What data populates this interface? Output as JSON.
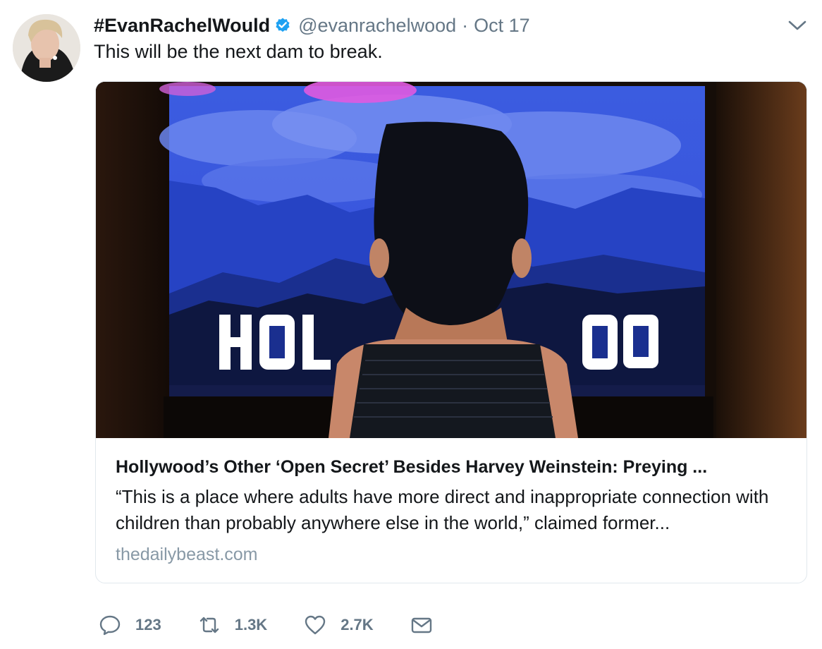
{
  "tweet": {
    "display_name": "#EvanRachelWould",
    "handle": "@evanrachelwood",
    "separator": "·",
    "date": "Oct 17",
    "text": "This will be the next dam to break."
  },
  "card": {
    "image_sign_text": "HOLLYWOOD",
    "title": "Hollywood’s Other ‘Open Secret’ Besides Harvey Weinstein: Preying ...",
    "description": "“This is a place where adults have more direct and inappropriate connection with children than probably anywhere else in the world,” claimed former...",
    "domain": "thedailybeast.com"
  },
  "actions": {
    "replies": "123",
    "retweets": "1.3K",
    "likes": "2.7K"
  },
  "icons": {
    "verified": "verified-badge-icon",
    "caret": "chevron-down-icon",
    "reply": "reply-bubble-icon",
    "retweet": "retweet-icon",
    "like": "heart-icon",
    "dm": "envelope-icon"
  },
  "colors": {
    "verified_blue": "#1da1f2",
    "meta_gray": "#657786",
    "domain_gray": "#8899a6",
    "text": "#14171a"
  }
}
